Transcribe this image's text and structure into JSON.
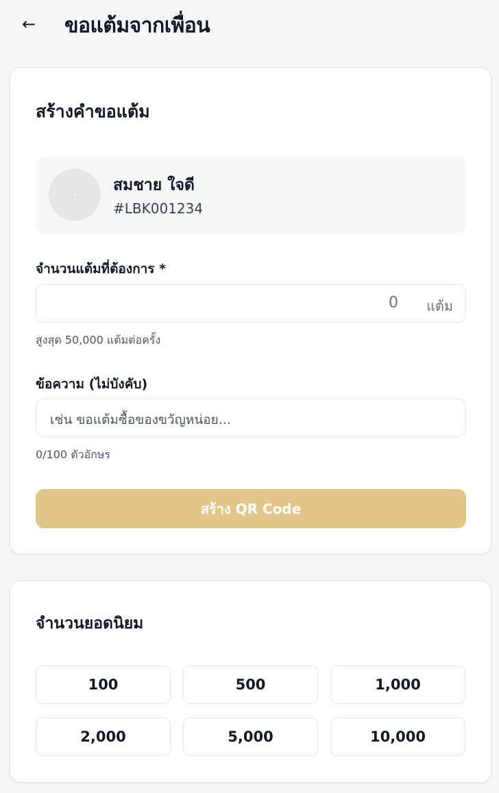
{
  "header": {
    "back_icon": "←",
    "title": "ขอแต้มจากเพื่อน"
  },
  "create_card": {
    "title": "สร้างคำขอแต้ม",
    "friend": {
      "name": "สมชาย ใจดี",
      "id": "#LBK001234"
    },
    "amount_label": "จำนวนแต้มที่ต้องการ *",
    "amount_value": "0",
    "amount_unit": "แต้ม",
    "amount_hint": "สูงสุด 50,000 แต้มต่อครั้ง",
    "message_label": "ข้อความ (ไม่บังคับ)",
    "message_placeholder": "เช่น ขอแต้มซื้อของขวัญหน่อย...",
    "message_counter": "0/100 ตัวอักษร",
    "submit_label": "สร้าง QR Code"
  },
  "popular_card": {
    "title": "จำนวนยอดนิยม",
    "presets": [
      "100",
      "500",
      "1,000",
      "2,000",
      "5,000",
      "10,000"
    ]
  },
  "colors": {
    "accent": "#e2c689",
    "background": "#f5f6f8"
  }
}
